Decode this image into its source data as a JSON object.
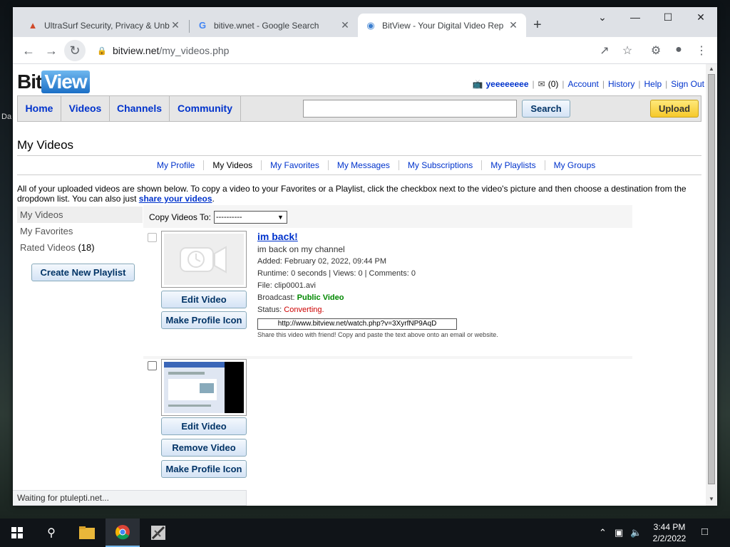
{
  "desktop": {
    "edge_text": "Da"
  },
  "browser": {
    "tabs": [
      {
        "title": "UltraSurf Security, Privacy & Unb",
        "icon": "ultrasurf-icon"
      },
      {
        "title": "bitive.wnet - Google Search",
        "icon": "google-icon"
      },
      {
        "title": "BitView - Your Digital Video Rep",
        "icon": "bitview-icon",
        "active": true
      }
    ],
    "url_host": "bitview.net",
    "url_path": "/my_videos.php",
    "status_text": "Waiting for ptulepti.net..."
  },
  "site": {
    "logo_bit": "Bit",
    "logo_view": "View",
    "user": {
      "username": "yeeeeeeee",
      "inbox_count": "(0)",
      "links": [
        "Account",
        "History",
        "Help",
        "Sign Out"
      ]
    },
    "nav": [
      "Home",
      "Videos",
      "Channels",
      "Community"
    ],
    "search_button": "Search",
    "upload_button": "Upload",
    "page_title": "My Videos",
    "subnav": [
      "My Profile",
      "My Videos",
      "My Favorites",
      "My Messages",
      "My Subscriptions",
      "My Playlists",
      "My Groups"
    ],
    "intro_text": "All of your uploaded videos are shown below. To copy a video to your Favorites or a Playlist, click the checkbox next to the video's picture and then choose a destination from the dropdown list. You can also just ",
    "intro_link": "share your videos",
    "intro_end": ".",
    "sidebar": {
      "my_videos": "My Videos",
      "my_favorites": "My Favorites",
      "rated_videos": "Rated Videos",
      "rated_count": "(18)",
      "create_playlist": "Create New Playlist"
    },
    "copy_to_label": "Copy Videos To:",
    "copy_to_value": "----------",
    "videos": [
      {
        "title": "im back!",
        "description": "im back on my channel",
        "added": "Added: February 02, 2022, 09:44 PM",
        "stats": "Runtime: 0 seconds | Views: 0 | Comments: 0",
        "file": "File: clip0001.avi",
        "broadcast_label": "Broadcast: ",
        "broadcast_value": "Public Video",
        "status_label": "Status: ",
        "status_value": "Converting.",
        "share_url": "http://www.bitview.net/watch.php?v=3XyrfNP9AqD",
        "share_note": "Share this video with friend! Copy and paste the text above onto an email or website.",
        "buttons": [
          "Edit Video",
          "Make Profile Icon"
        ]
      },
      {
        "buttons": [
          "Edit Video",
          "Remove Video",
          "Make Profile Icon"
        ]
      }
    ]
  },
  "taskbar": {
    "time": "3:44 PM",
    "date": "2/2/2022"
  }
}
